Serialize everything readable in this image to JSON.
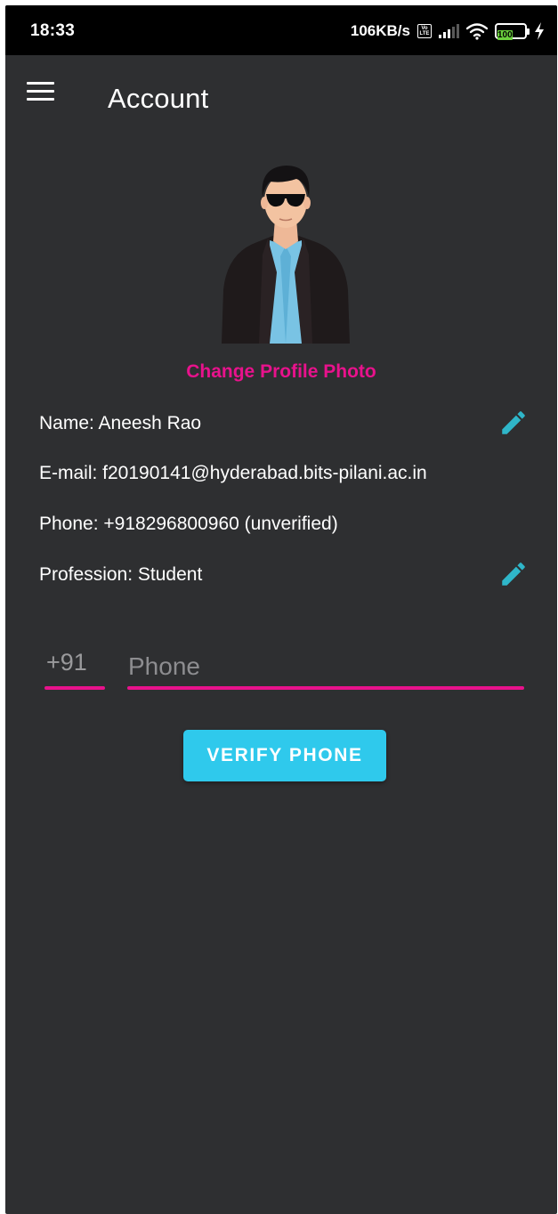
{
  "status_bar": {
    "time": "18:33",
    "net_speed": "106KB/s",
    "volte_label": "Vo LTE",
    "battery_level": "100"
  },
  "app_bar": {
    "title": "Account",
    "menu_icon": "hamburger-menu-icon"
  },
  "profile": {
    "change_photo_label": "Change Profile Photo",
    "avatar_icon": "avatar-man-sunglasses"
  },
  "info": {
    "name": "Name: Aneesh Rao",
    "email": "E-mail: f20190141@hyderabad.bits-pilani.ac.in",
    "phone": "Phone: +918296800960 (unverified)",
    "profession": "Profession: Student",
    "edit_icon": "pencil-edit-icon"
  },
  "phone_form": {
    "country_code": "+91",
    "phone_placeholder": "Phone",
    "phone_value": "",
    "verify_label": "VERIFY PHONE"
  },
  "colors": {
    "background": "#2e2f31",
    "accent_pink": "#e8128c",
    "accent_cyan": "#2fc9ec",
    "edit_icon": "#2fb6c9",
    "battery_green": "#6bd03e"
  }
}
